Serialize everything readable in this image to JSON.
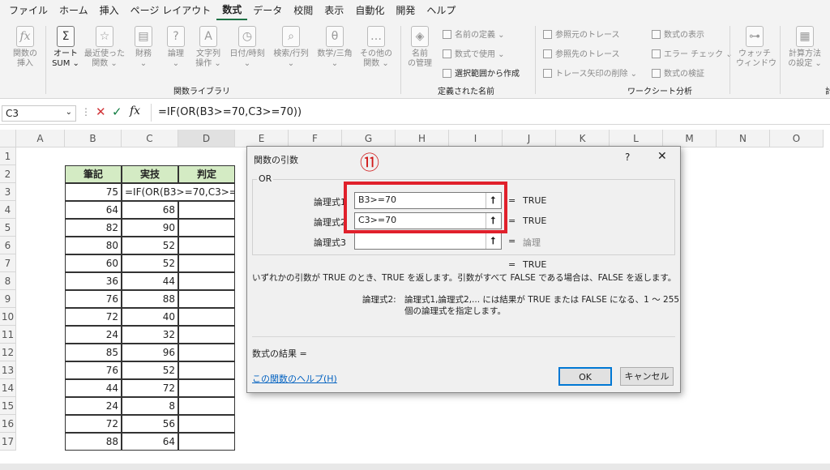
{
  "menu": [
    "ファイル",
    "ホーム",
    "挿入",
    "ページ レイアウト",
    "数式",
    "データ",
    "校閲",
    "表示",
    "自動化",
    "開発",
    "ヘルプ"
  ],
  "ribbon": {
    "insert_fn": "関数の\n挿入",
    "autosum": "オート\nSUM ⌄",
    "recent": "最近使った\n関数 ⌄",
    "finance": "財務\n⌄",
    "logic": "論理\n⌄",
    "text": "文字列\n操作 ⌄",
    "datetime": "日付/時刻\n⌄",
    "lookup": "検索/行列\n⌄",
    "math": "数学/三角\n⌄",
    "other": "その他の\n関数 ⌄",
    "group_lib": "関数ライブラリ",
    "name_mgr": "名前\nの管理",
    "define": "名前の定義 ⌄",
    "use_in": "数式で使用 ⌄",
    "create_sel": "選択範囲から作成",
    "group_names": "定義された名前",
    "trace_prec": "参照元のトレース",
    "trace_dep": "参照先のトレース",
    "remove_arrows": "トレース矢印の削除 ⌄",
    "show_formulas": "数式の表示",
    "error_check": "エラー チェック ⌄",
    "eval_formula": "数式の検証",
    "group_audit": "ワークシート分析",
    "watch": "ウォッチ\nウィンドウ",
    "calc_opts": "計算方法\nの設定 ⌄",
    "cut_label": "計"
  },
  "formula_bar": {
    "name": "C3",
    "formula": "=IF(OR(B3>=70,C3>=70))"
  },
  "columns": [
    "A",
    "B",
    "C",
    "D",
    "E",
    "F",
    "G",
    "H",
    "I",
    "J",
    "K",
    "L",
    "M",
    "N",
    "O"
  ],
  "rows": [
    "1",
    "2",
    "3",
    "4",
    "5",
    "6",
    "7",
    "8",
    "9",
    "10",
    "11",
    "12",
    "13",
    "14",
    "15",
    "16",
    "17"
  ],
  "table": {
    "headers": [
      "筆記",
      "実技",
      "判定"
    ],
    "b3": "75",
    "c3_formula": "=IF(OR(B3>=70,C3>=",
    "data": [
      [
        "64",
        "68"
      ],
      [
        "82",
        "90"
      ],
      [
        "80",
        "52"
      ],
      [
        "60",
        "52"
      ],
      [
        "36",
        "44"
      ],
      [
        "76",
        "88"
      ],
      [
        "72",
        "40"
      ],
      [
        "24",
        "32"
      ],
      [
        "85",
        "96"
      ],
      [
        "76",
        "52"
      ],
      [
        "44",
        "72"
      ],
      [
        "24",
        "8"
      ],
      [
        "72",
        "56"
      ],
      [
        "88",
        "64"
      ]
    ]
  },
  "dialog": {
    "title": "関数の引数",
    "help_q": "?",
    "close": "✕",
    "fn_name": "OR",
    "arg1_label": "論理式1",
    "arg1_value": "B3>=70",
    "arg1_result": "TRUE",
    "arg2_label": "論理式2",
    "arg2_value": "C3>=70",
    "arg2_result": "TRUE",
    "arg3_label": "論理式3",
    "arg3_result": "論理",
    "eq": "=",
    "overall_result": "TRUE",
    "desc": "いずれかの引数が TRUE のとき、TRUE を返します。引数がすべて FALSE である場合は、FALSE を返します。",
    "arg_desc_label": "論理式2:",
    "arg_desc": "論理式1,論理式2,... には結果が TRUE または FALSE になる、1 〜 255\n個の論理式を指定します。",
    "formula_result": "数式の結果 =",
    "help_link": "この関数のヘルプ(H)",
    "ok": "OK",
    "cancel": "キャンセル"
  },
  "callout": "⑪",
  "colors": {
    "header_fill": "#d4ebc4",
    "red_box": "#e0202b",
    "accent": "#1e7145"
  }
}
